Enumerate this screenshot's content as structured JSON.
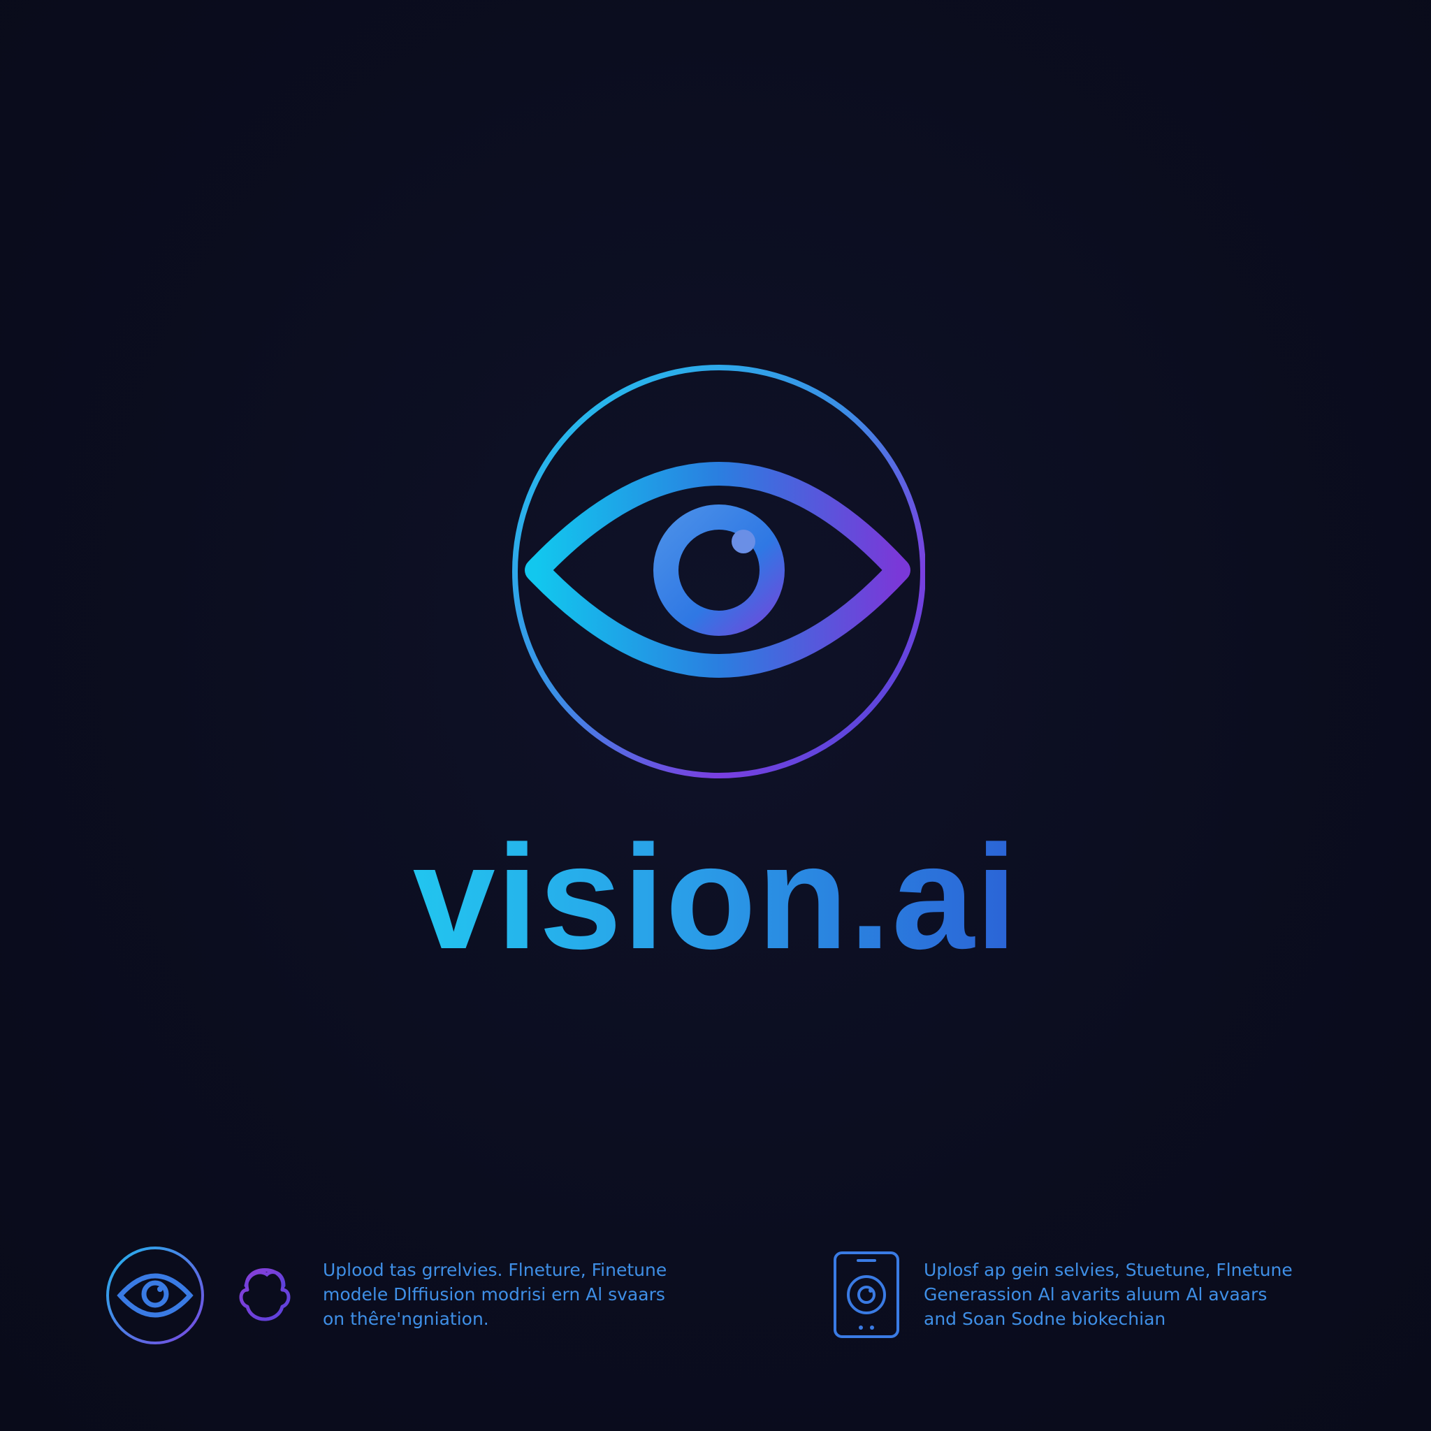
{
  "brand": {
    "name": "vision.ai",
    "logo_icon": "eye-in-circle-icon",
    "gradient_colors": [
      "#12c7ee",
      "#2a7fe0",
      "#7a3fe0",
      "#5a3ad6"
    ]
  },
  "background_color": "#0b0d1f",
  "features": [
    {
      "icons": [
        "eye-circle-icon",
        "user-head-icon"
      ],
      "lines": [
        "Uplood tas grrelvies. Flneture, Finetune",
        "modele Dlffiusion  modrisi ern Al svaars",
        "on thêre'ngniation."
      ]
    },
    {
      "icons": [
        "smartphone-camera-icon"
      ],
      "lines": [
        "Uplosf ap gein selvies, Stuetune, Flnetune",
        "Generassion Al avarits aluum Al avaars",
        "and Soan Sodne biokechian"
      ]
    }
  ],
  "text_color": "#3f8fe6"
}
